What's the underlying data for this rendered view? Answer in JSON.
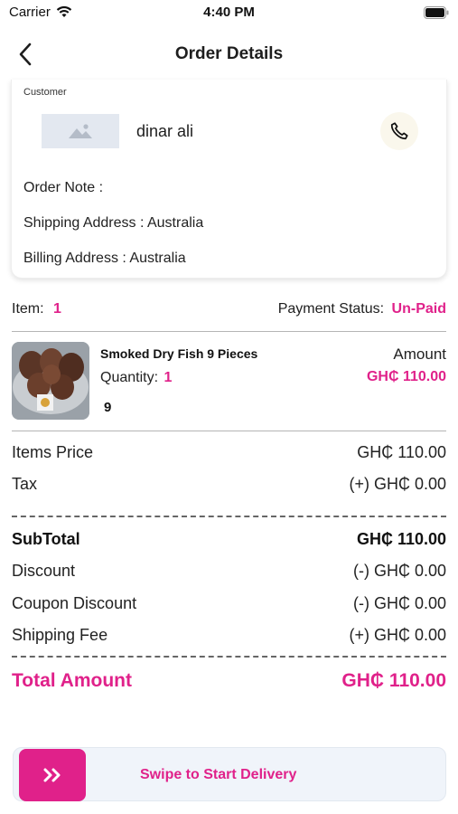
{
  "status_bar": {
    "carrier": "Carrier",
    "time": "4:40 PM",
    "icons": [
      "wifi-icon",
      "battery-icon"
    ]
  },
  "nav": {
    "title": "Order Details",
    "back_icon": "chevron-left-icon"
  },
  "customer": {
    "label": "Customer",
    "name": "dinar ali",
    "avatar_icon": "image-placeholder-icon",
    "call_icon": "phone-icon",
    "order_note": "Order Note :",
    "shipping_address": "Shipping Address : Australia",
    "billing_address": "Billing Address : Australia"
  },
  "order_summary": {
    "item_label": "Item:",
    "item_count": "1",
    "payment_status_label": "Payment Status:",
    "payment_status_value": "Un-Paid"
  },
  "product": {
    "name": "Smoked Dry Fish 9 Pieces",
    "quantity_label": "Quantity:",
    "quantity_value": "1",
    "extra": "9",
    "amount_label": "Amount",
    "amount_value": "GH₵ 110.00"
  },
  "totals": {
    "items_price_label": "Items Price",
    "items_price_value": "GH₵ 110.00",
    "tax_label": "Tax",
    "tax_value": "(+) GH₵ 0.00",
    "subtotal_label": "SubTotal",
    "subtotal_value": "GH₵ 110.00",
    "discount_label": "Discount",
    "discount_value": "(-) GH₵ 0.00",
    "coupon_label": "Coupon Discount",
    "coupon_value": "(-) GH₵ 0.00",
    "shipping_label": "Shipping Fee",
    "shipping_value": "(+) GH₵ 0.00",
    "total_label": "Total Amount",
    "total_value": "GH₵ 110.00"
  },
  "swipe": {
    "text": "Swipe to Start Delivery",
    "handle_icon": "double-chevron-right-icon"
  },
  "colors": {
    "accent": "#e0218a",
    "swipe_background": "#f0f4fa"
  }
}
